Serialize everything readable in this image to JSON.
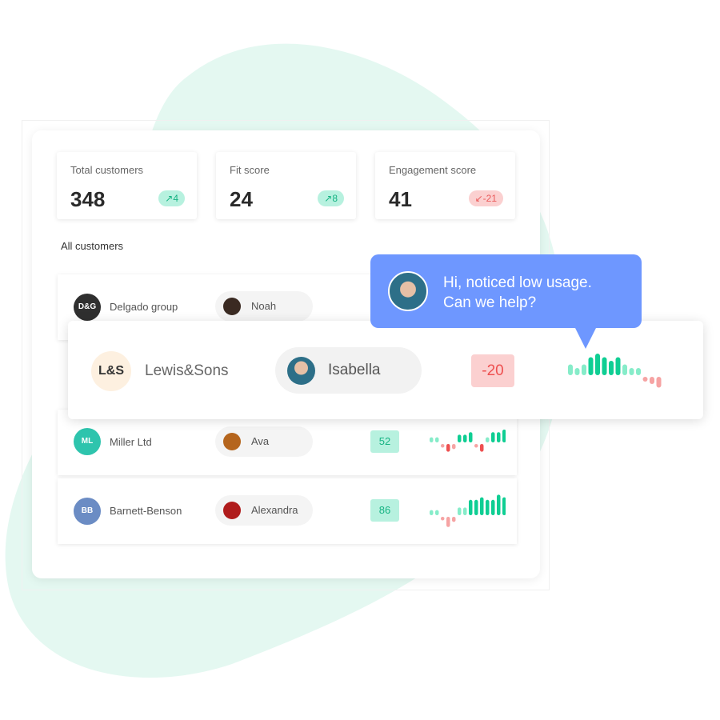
{
  "stats": [
    {
      "label": "Total customers",
      "value": "348",
      "delta": "4",
      "trend": "up",
      "icon": "arrow-up-right-icon"
    },
    {
      "label": "Fit score",
      "value": "24",
      "delta": "8",
      "trend": "up",
      "icon": "arrow-up-right-icon"
    },
    {
      "label": "Engagement score",
      "value": "41",
      "delta": "-21",
      "trend": "down",
      "icon": "arrow-down-left-icon"
    }
  ],
  "section_title": "All customers",
  "customers": [
    {
      "initials": "D&G",
      "company": "Delgado group",
      "contact": "Noah",
      "logo_color": "#2f2f2f"
    },
    {
      "initials": "L&S",
      "company": "Lewis&Sons",
      "contact": "Isabella",
      "score": "-20",
      "logo_color": "#fdf0e0",
      "spark": [
        3,
        2,
        3,
        5,
        6,
        5,
        4,
        5,
        3,
        2,
        2,
        -1,
        -2,
        -3
      ]
    },
    {
      "initials": "ML",
      "company": "Miller Ltd",
      "contact": "Ava",
      "score": "52",
      "logo_color": "#2ec4ad",
      "spark": [
        2,
        2,
        -1,
        -3,
        -2,
        3,
        3,
        4,
        -1,
        -3,
        2,
        4,
        4,
        5
      ]
    },
    {
      "initials": "BB",
      "company": "Barnett-Benson",
      "contact": "Alexandra",
      "score": "86",
      "logo_color": "#6b8cc4",
      "spark": [
        2,
        2,
        -1,
        -4,
        -2,
        3,
        3,
        6,
        6,
        7,
        6,
        6,
        8,
        7
      ]
    }
  ],
  "chat": {
    "line1": "Hi, noticed low usage.",
    "line2": "Can we help?"
  },
  "colors": {
    "positive": "#0fce93",
    "negative": "#ee5050",
    "bubble": "#6e97ff",
    "blob": "#e4f8f1"
  }
}
